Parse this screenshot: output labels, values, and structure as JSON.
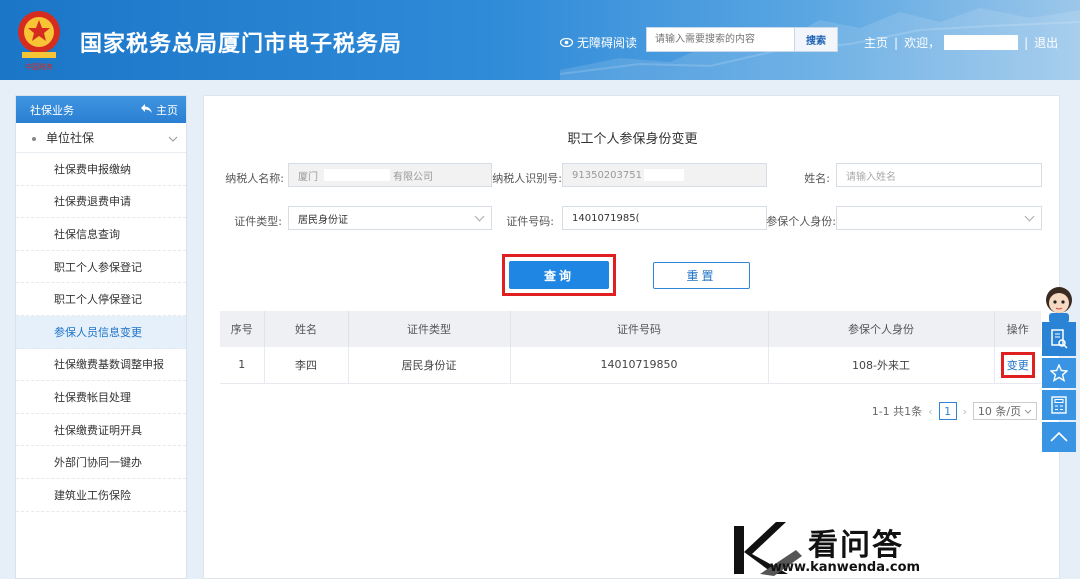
{
  "header": {
    "site_title": "国家税务总局厦门市电子税务局",
    "accessible_label": "无障碍阅读",
    "search_placeholder": "请输入需要搜索的内容",
    "search_button": "搜索",
    "nav_home": "主页",
    "nav_sep": "|",
    "welcome": "欢迎，",
    "logout": "退出"
  },
  "sidebar": {
    "title": "社保业务",
    "home": "主页",
    "group": "单位社保",
    "items": [
      {
        "label": "社保费申报缴纳"
      },
      {
        "label": "社保费退费申请"
      },
      {
        "label": "社保信息查询"
      },
      {
        "label": "职工个人参保登记"
      },
      {
        "label": "职工个人停保登记"
      },
      {
        "label": "参保人员信息变更"
      },
      {
        "label": "社保缴费基数调整申报"
      },
      {
        "label": "社保费帐目处理"
      },
      {
        "label": "社保缴费证明开具"
      },
      {
        "label": "外部门协同一键办"
      },
      {
        "label": "建筑业工伤保险"
      }
    ],
    "active_index": 5
  },
  "form": {
    "title": "职工个人参保身份变更",
    "taxpayer_name_label": "纳税人名称:",
    "taxpayer_name_value_start": "厦门",
    "taxpayer_name_value_end": "有限公司",
    "taxpayer_id_label": "纳税人识别号:",
    "taxpayer_id_value": "91350203751",
    "name_label": "姓名:",
    "name_placeholder": "请输入姓名",
    "id_type_label": "证件类型:",
    "id_type_value": "居民身份证",
    "id_number_label": "证件号码:",
    "id_number_value": "1401071985(",
    "identity_label": "参保个人身份:",
    "identity_value": "",
    "query_button": "查询",
    "reset_button": "重置"
  },
  "table": {
    "headers": [
      "序号",
      "姓名",
      "证件类型",
      "证件号码",
      "参保个人身份",
      "操作"
    ],
    "rows": [
      {
        "no": "1",
        "name": "李四",
        "id_type": "居民身份证",
        "id_number": "14010719850",
        "identity": "108-外来工",
        "action": "变更"
      }
    ]
  },
  "pager": {
    "summary": "1-1 共1条",
    "current_page": "1",
    "page_size": "10 条/页"
  },
  "watermark": {
    "text": "看问答",
    "url": "www.kanwenda.com"
  },
  "colors": {
    "primary": "#1f86e3",
    "highlight_border": "#e02020",
    "header_bg": "#1b76c8"
  }
}
